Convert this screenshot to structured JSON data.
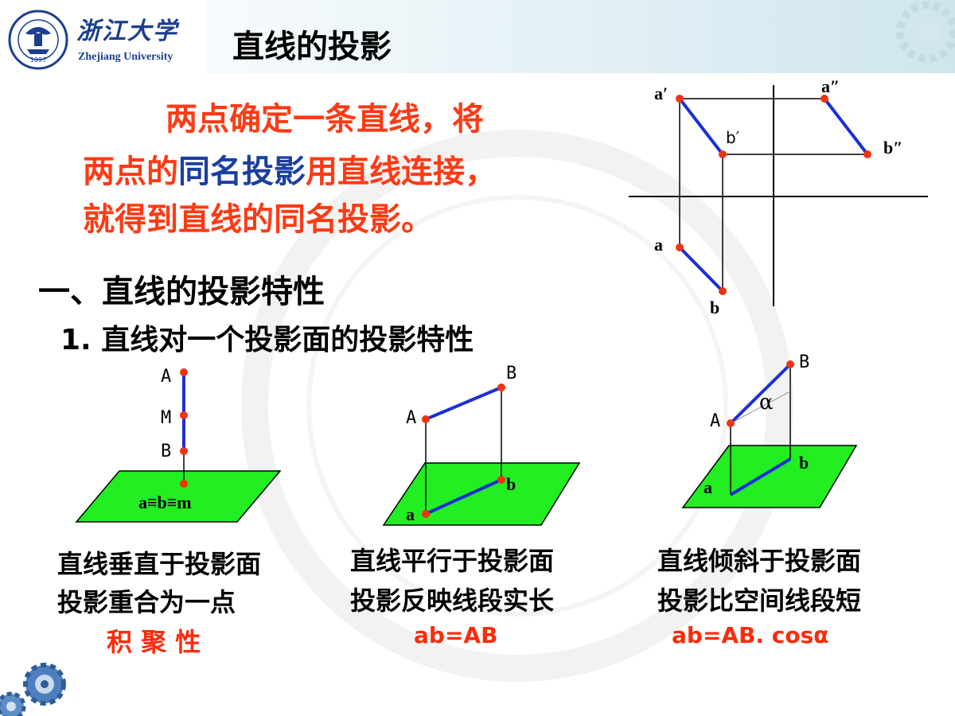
{
  "header": {
    "university_cn": "浙江大学",
    "university_en": "Zhejiang University",
    "logo_seal_text": "ZHEJIANG UNIVERSITY",
    "logo_year": "1897",
    "title": "直线的投影"
  },
  "intro": {
    "line1": "两点确定一条直线，将",
    "line2_before": "两点的",
    "line2_highlight": "同名投影",
    "line2_after": "用直线连接，",
    "line3": "就得到直线的同名投影。"
  },
  "section": {
    "heading": "一、直线的投影特性",
    "subheading": "1. 直线对一个投影面的投影特性"
  },
  "projection_diagram": {
    "labels": {
      "a1": "a′",
      "a2": "a″",
      "b1": "b′",
      "b2": "b″",
      "a": "a",
      "b": "b"
    }
  },
  "cases": [
    {
      "labels": {
        "A": "A",
        "M": "M",
        "B": "B",
        "proj": "a≡b≡m"
      },
      "caption1": "直线垂直于投影面",
      "caption2": "投影重合为一点",
      "property": "积 聚 性"
    },
    {
      "labels": {
        "A": "A",
        "B": "B",
        "a": "a",
        "b": "b"
      },
      "caption1": "直线平行于投影面",
      "caption2": "投影反映线段实长",
      "property": "ab=AB"
    },
    {
      "labels": {
        "A": "A",
        "B": "B",
        "a": "a",
        "b": "b",
        "angle": "α"
      },
      "caption1": "直线倾斜于投影面",
      "caption2": "投影比空间线段短",
      "property": "ab=AB. cosα"
    }
  ],
  "colors": {
    "intro_text": "#ff3a14",
    "highlight": "#1b3fa0",
    "plane_fill": "#22ee22",
    "line_blue": "#1a2fd6",
    "point_red": "#ee3311"
  }
}
